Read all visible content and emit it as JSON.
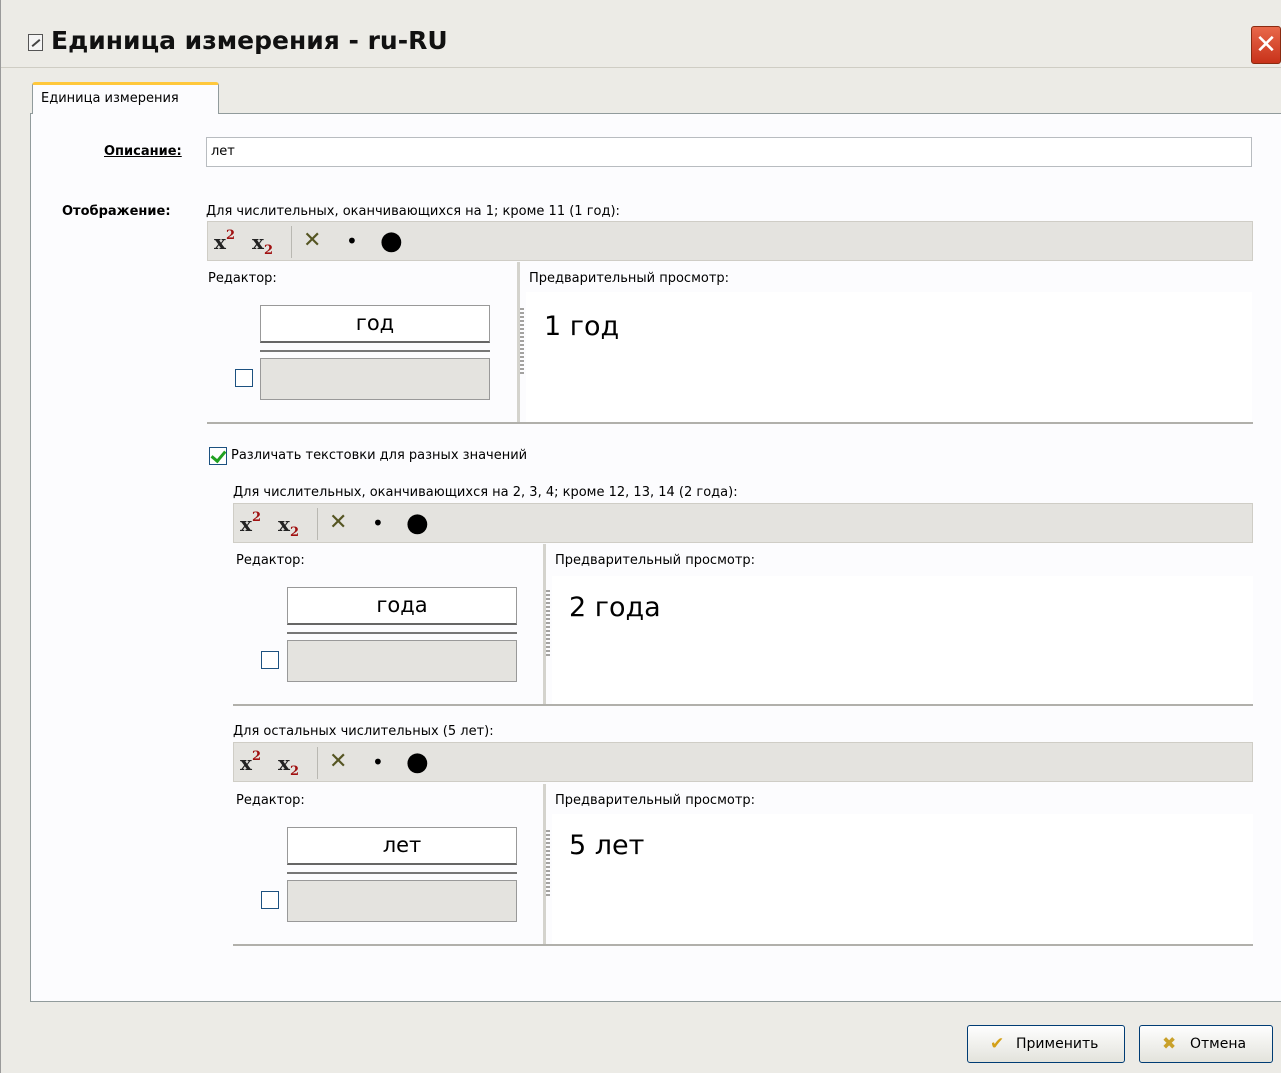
{
  "window": {
    "title": "Единица измерения - ru-RU",
    "close_glyph": "✕"
  },
  "tab": {
    "label": "Единица измерения"
  },
  "description": {
    "label": "Описание:",
    "value": "лет"
  },
  "display": {
    "label": "Отображение:",
    "toolbar": {
      "superscript": "x",
      "superscript_mark": "2",
      "subscript": "x",
      "subscript_mark": "2",
      "clear": "✕",
      "dot_small": "•",
      "dot_large": "●"
    },
    "sections": [
      {
        "heading": "Для числительных, оканчивающихся на 1; кроме 11 (1 год):",
        "editor_label": "Редактор:",
        "preview_label": "Предварительный просмотр:",
        "editor_value": "год",
        "preview_value": "1 год",
        "checkbox_checked": false
      },
      {
        "heading": "Для числительных, оканчивающихся на 2, 3, 4; кроме 12, 13, 14 (2 года):",
        "editor_label": "Редактор:",
        "preview_label": "Предварительный просмотр:",
        "editor_value": "года",
        "preview_value": "2 года",
        "checkbox_checked": false
      },
      {
        "heading": "Для остальных числительных (5 лет):",
        "editor_label": "Редактор:",
        "preview_label": "Предварительный просмотр:",
        "editor_value": "лет",
        "preview_value": "5 лет",
        "checkbox_checked": false
      }
    ],
    "distinguish": {
      "label": "Различать текстовки для разных значений",
      "checked": true
    }
  },
  "buttons": {
    "apply": "Применить",
    "cancel": "Отмена"
  },
  "colors": {
    "dialog_bg": "#ecebe6",
    "panel_bg": "#fcfcfe",
    "tab_highlight": "#ffc83c",
    "close_red": "#c8321a"
  }
}
